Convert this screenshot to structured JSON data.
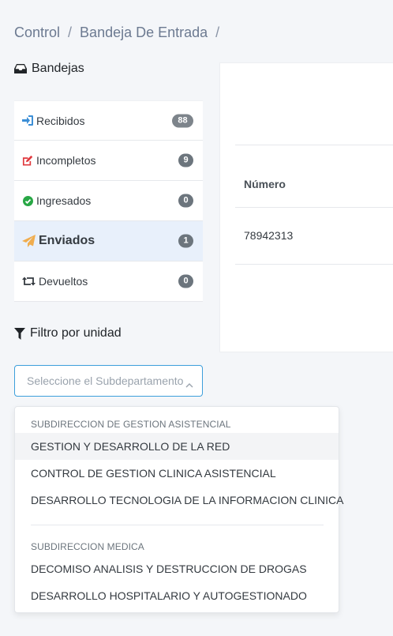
{
  "breadcrumb": {
    "items": [
      "Control",
      "Bandeja De Entrada"
    ],
    "separator": "/"
  },
  "inboxes": {
    "title": "Bandejas",
    "title_icon": "inbox-icon",
    "items": [
      {
        "label": "Recibidos",
        "count": "88",
        "icon": "sign-in-icon",
        "color": "#3d8fd6"
      },
      {
        "label": "Incompletos",
        "count": "9",
        "icon": "edit-icon",
        "color": "#e0393e"
      },
      {
        "label": "Ingresados",
        "count": "0",
        "icon": "check-circle-icon",
        "color": "#28a745"
      },
      {
        "label": "Enviados",
        "count": "1",
        "icon": "paper-plane-icon",
        "color": "#f0ad4e",
        "active": true
      },
      {
        "label": "Devueltos",
        "count": "0",
        "icon": "retweet-icon",
        "color": "#343a40"
      }
    ]
  },
  "filter": {
    "title": "Filtro por unidad",
    "title_icon": "filter-icon",
    "select_placeholder": "Seleccione el Subdepartamento",
    "dropdown": {
      "groups": [
        {
          "label": "SUBDIRECCION DE GESTION ASISTENCIAL",
          "options": [
            "GESTION Y DESARROLLO DE LA RED",
            "CONTROL DE GESTION CLINICA ASISTENCIAL",
            "DESARROLLO TECNOLOGIA DE LA INFORMACION CLINICA"
          ]
        },
        {
          "label": "SUBDIRECCION MEDICA",
          "options": [
            "DECOMISO ANALISIS Y DESTRUCCION DE DROGAS",
            "DESARROLLO HOSPITALARIO Y AUTOGESTIONADO"
          ]
        }
      ],
      "highlighted_option": "GESTION Y DESARROLLO DE LA RED"
    }
  },
  "table": {
    "column_header": "Número",
    "rows": [
      {
        "numero": "78942313"
      }
    ]
  },
  "colors": {
    "accent": "#3d9fdb",
    "active_bg": "#e8f0fb",
    "badge": "#6c757d",
    "page_bg": "#f4f6f9"
  }
}
